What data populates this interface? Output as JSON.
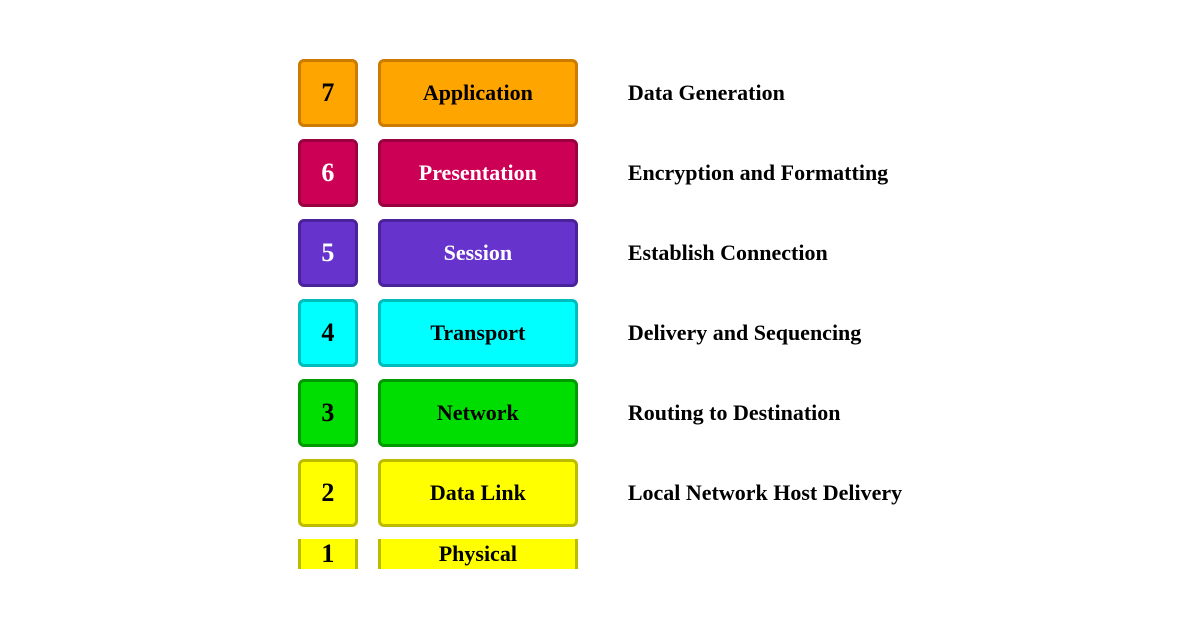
{
  "layers": [
    {
      "id": 7,
      "number": "7",
      "label": "Application",
      "description": "Data Generation",
      "css_class": "layer-7"
    },
    {
      "id": 6,
      "number": "6",
      "label": "Presentation",
      "description": "Encryption and Formatting",
      "css_class": "layer-6"
    },
    {
      "id": 5,
      "number": "5",
      "label": "Session",
      "description": "Establish Connection",
      "css_class": "layer-5"
    },
    {
      "id": 4,
      "number": "4",
      "label": "Transport",
      "description": "Delivery and Sequencing",
      "css_class": "layer-4"
    },
    {
      "id": 3,
      "number": "3",
      "label": "Network",
      "description": "Routing to Destination",
      "css_class": "layer-3"
    },
    {
      "id": 2,
      "number": "2",
      "label": "Data Link",
      "description": "Local Network Host Delivery",
      "css_class": "layer-2"
    },
    {
      "id": 1,
      "number": "1",
      "label": "Physical",
      "description": "",
      "css_class": "layer-1"
    }
  ]
}
